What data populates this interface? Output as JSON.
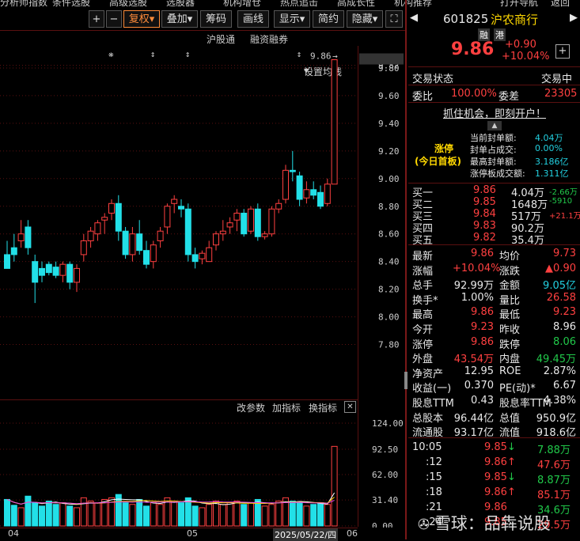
{
  "top_menu": [
    "分析师指数",
    "条件选股",
    "高级选股",
    "选股器",
    "机构增仓",
    "热点追击",
    "高成长性",
    "机构推荐",
    "打开导航",
    "返回"
  ],
  "toolbar": {
    "plus": "+",
    "minus": "−",
    "adjust": "复权",
    "overlay": "叠加",
    "chips": "筹码",
    "draw": "画线",
    "display": "显示",
    "simple": "简约",
    "hide": "隐藏"
  },
  "chart_menu": {
    "hgt": "沪股通",
    "margin": "融资融券",
    "ma": "设置均线"
  },
  "kchart": {
    "price_axis": [
      "9.82",
      "9.80",
      "9.60",
      "9.40",
      "9.20",
      "9.00",
      "8.80",
      "8.60",
      "8.40",
      "8.20",
      "8.00",
      "7.80"
    ],
    "last_price_tag": "9.86",
    "markers": [
      "❋",
      "↕",
      "↕",
      "↕"
    ]
  },
  "vchart": {
    "menu": {
      "params": "改参数",
      "add": "加指标",
      "switch": "换指标"
    },
    "axis": [
      "124.00",
      "92.50",
      "62.00",
      "31.40",
      "0.00"
    ]
  },
  "xaxis": {
    "m04": "04",
    "m05": "05",
    "date": "2025/05/22/四",
    "m06": "06"
  },
  "chart_data": {
    "type": "candlestick",
    "price_range": [
      7.66,
      9.88
    ],
    "candles": [
      [
        8.45,
        8.55,
        8.35,
        8.35
      ],
      [
        8.5,
        8.6,
        8.4,
        8.45
      ],
      [
        8.55,
        8.7,
        8.5,
        8.6
      ],
      [
        8.65,
        8.7,
        8.45,
        8.5
      ],
      [
        8.4,
        8.45,
        8.1,
        8.25
      ],
      [
        8.35,
        8.4,
        8.25,
        8.3
      ],
      [
        8.38,
        8.4,
        8.3,
        8.32
      ],
      [
        8.36,
        8.4,
        8.28,
        8.3
      ],
      [
        8.3,
        8.4,
        8.25,
        8.38
      ],
      [
        8.38,
        8.4,
        8.2,
        8.25
      ],
      [
        8.25,
        8.38,
        8.18,
        8.35
      ],
      [
        8.45,
        8.6,
        8.4,
        8.55
      ],
      [
        8.55,
        8.65,
        8.5,
        8.62
      ],
      [
        8.6,
        8.7,
        8.55,
        8.68
      ],
      [
        8.7,
        8.75,
        8.6,
        8.72
      ],
      [
        8.75,
        8.85,
        8.7,
        8.82
      ],
      [
        8.82,
        8.88,
        8.55,
        8.62
      ],
      [
        8.62,
        8.65,
        8.42,
        8.45
      ],
      [
        8.45,
        8.65,
        8.4,
        8.6
      ],
      [
        8.6,
        8.7,
        8.45,
        8.48
      ],
      [
        8.48,
        8.55,
        8.35,
        8.38
      ],
      [
        8.4,
        8.55,
        8.35,
        8.52
      ],
      [
        8.55,
        8.65,
        8.5,
        8.62
      ],
      [
        8.65,
        8.82,
        8.6,
        8.8
      ],
      [
        8.82,
        8.88,
        8.75,
        8.85
      ],
      [
        8.8,
        8.85,
        8.72,
        8.78
      ],
      [
        8.78,
        8.82,
        8.4,
        8.45
      ],
      [
        8.45,
        8.5,
        8.35,
        8.4
      ],
      [
        8.42,
        8.48,
        8.38,
        8.46
      ],
      [
        8.4,
        8.55,
        8.4,
        8.5
      ],
      [
        8.52,
        8.62,
        8.48,
        8.6
      ],
      [
        8.6,
        8.7,
        8.55,
        8.62
      ],
      [
        8.65,
        8.72,
        8.6,
        8.68
      ],
      [
        8.7,
        8.78,
        8.62,
        8.75
      ],
      [
        8.75,
        8.78,
        8.58,
        8.6
      ],
      [
        8.62,
        8.8,
        8.6,
        8.78
      ],
      [
        8.78,
        8.82,
        8.55,
        8.58
      ],
      [
        8.58,
        8.62,
        8.56,
        8.6
      ],
      [
        8.6,
        8.8,
        8.58,
        8.78
      ],
      [
        8.78,
        8.85,
        8.75,
        8.82
      ],
      [
        8.85,
        9.1,
        8.82,
        9.06
      ],
      [
        9.06,
        9.2,
        8.98,
        9.05
      ],
      [
        9.02,
        9.05,
        8.8,
        8.85
      ],
      [
        8.86,
        8.98,
        8.82,
        8.92
      ],
      [
        8.92,
        8.98,
        8.85,
        8.88
      ],
      [
        8.9,
        8.95,
        8.78,
        8.8
      ],
      [
        8.82,
        9.0,
        8.8,
        8.96
      ],
      [
        8.96,
        9.86,
        8.96,
        9.86
      ]
    ],
    "volumes": [
      32,
      25,
      22,
      36,
      28,
      24,
      30,
      26,
      28,
      24,
      22,
      34,
      30,
      28,
      32,
      34,
      38,
      28,
      26,
      32,
      24,
      28,
      26,
      34,
      30,
      28,
      34,
      24,
      22,
      26,
      30,
      26,
      28,
      30,
      26,
      28,
      32,
      24,
      26,
      30,
      34,
      30,
      28,
      24,
      26,
      28,
      26,
      96
    ],
    "volume_range": [
      0,
      124
    ]
  },
  "quote": {
    "code": "601825",
    "name": "沪农商行",
    "tag1": "融",
    "tag2": "港",
    "price": "9.86",
    "change": "+0.90",
    "pct": "+10.04%",
    "trade_status_label": "交易状态",
    "trade_status": "交易中",
    "ratio_label": "委比",
    "ratio": "100.00%",
    "diff_label": "委差",
    "diff": "23305",
    "promo": "抓住机会，即刻开户！",
    "limit_title": "涨停\n(今日首板)",
    "limit_rows": [
      {
        "k": "当前封单额:",
        "v": "4.04万"
      },
      {
        "k": "封单占成交:",
        "v": "0.00%"
      },
      {
        "k": "最高封单额:",
        "v": "3.186亿"
      },
      {
        "k": "涨停板成交额:",
        "v": "1.311亿"
      }
    ],
    "orders": [
      {
        "k": "买一",
        "p": "9.86",
        "v": "4.04万",
        "d": "-2.66万",
        "dc": "green"
      },
      {
        "k": "买二",
        "p": "9.85",
        "v": "1648万",
        "d": "-5910",
        "dc": "green"
      },
      {
        "k": "买三",
        "p": "9.84",
        "v": "517万",
        "d": "+21.1万",
        "dc": "red"
      },
      {
        "k": "买四",
        "p": "9.83",
        "v": "90.2万",
        "d": "",
        "dc": "red"
      },
      {
        "k": "买五",
        "p": "9.82",
        "v": "35.4万",
        "d": "",
        "dc": "red"
      }
    ],
    "stats": [
      {
        "k1": "最新",
        "v1": "9.86",
        "c1": "red",
        "k2": "均价",
        "v2": "9.73",
        "c2": "red"
      },
      {
        "k1": "涨幅",
        "v1": "+10.04%",
        "c1": "red",
        "k2": "涨跌",
        "v2": "▲0.90",
        "c2": "red"
      },
      {
        "k1": "总手",
        "v1": "92.99万",
        "c1": "white",
        "k2": "金额",
        "v2": "9.05亿",
        "c2": "cyan"
      },
      {
        "k1": "换手*",
        "v1": "1.00%",
        "c1": "white",
        "k2": "量比",
        "v2": "26.58",
        "c2": "red"
      },
      {
        "k1": "最高",
        "v1": "9.86",
        "c1": "red",
        "k2": "最低",
        "v2": "9.23",
        "c2": "red"
      },
      {
        "k1": "今开",
        "v1": "9.23",
        "c1": "red",
        "k2": "昨收",
        "v2": "8.96",
        "c2": "white"
      },
      {
        "k1": "涨停",
        "v1": "9.86",
        "c1": "red",
        "k2": "跌停",
        "v2": "8.06",
        "c2": "green"
      },
      {
        "k1": "外盘",
        "v1": "43.54万",
        "c1": "red",
        "k2": "内盘",
        "v2": "49.45万",
        "c2": "green"
      },
      {
        "k1": "净资产",
        "v1": "12.95",
        "c1": "white",
        "k2": "ROE",
        "v2": "2.87%",
        "c2": "white"
      },
      {
        "k1": "收益(一)",
        "v1": "0.370",
        "c1": "white",
        "k2": "PE(动)*",
        "v2": "6.67",
        "c2": "white"
      },
      {
        "k1": "股息TTM",
        "v1": "0.43",
        "c1": "white",
        "k2": "股息率TTM",
        "v2": "4.38%",
        "c2": "white"
      },
      {
        "k1": "总股本",
        "v1": "96.44亿",
        "c1": "white",
        "k2": "总值",
        "v2": "950.9亿",
        "c2": "white"
      },
      {
        "k1": "流通股",
        "v1": "93.17亿",
        "c1": "white",
        "k2": "流值",
        "v2": "918.6亿",
        "c2": "white"
      }
    ],
    "ticks": [
      {
        "t": "10:05",
        "p": "9.85",
        "a": "↓",
        "ac": "green",
        "v": "7.88万",
        "vc": "green"
      },
      {
        "t": ":12",
        "p": "9.86",
        "a": "↑",
        "ac": "red",
        "v": "47.6万",
        "vc": "red"
      },
      {
        "t": ":15",
        "p": "9.85",
        "a": "↓",
        "ac": "green",
        "v": "8.87万",
        "vc": "green"
      },
      {
        "t": ":18",
        "p": "9.86",
        "a": "↑",
        "ac": "red",
        "v": "85.1万",
        "vc": "red"
      },
      {
        "t": ":21",
        "p": "9.86",
        "a": "",
        "ac": "red",
        "v": "34.6万",
        "vc": "green"
      },
      {
        "t": ":24",
        "p": "9.85",
        "a": "",
        "ac": "red",
        "v": "29.5万",
        "vc": "red"
      }
    ]
  },
  "watermark": "雪球：品犇说股",
  "colors": {
    "up": "#ff4040",
    "down": "#22e0e8",
    "grid": "#5a1010",
    "accent": "#ff8c3a"
  }
}
